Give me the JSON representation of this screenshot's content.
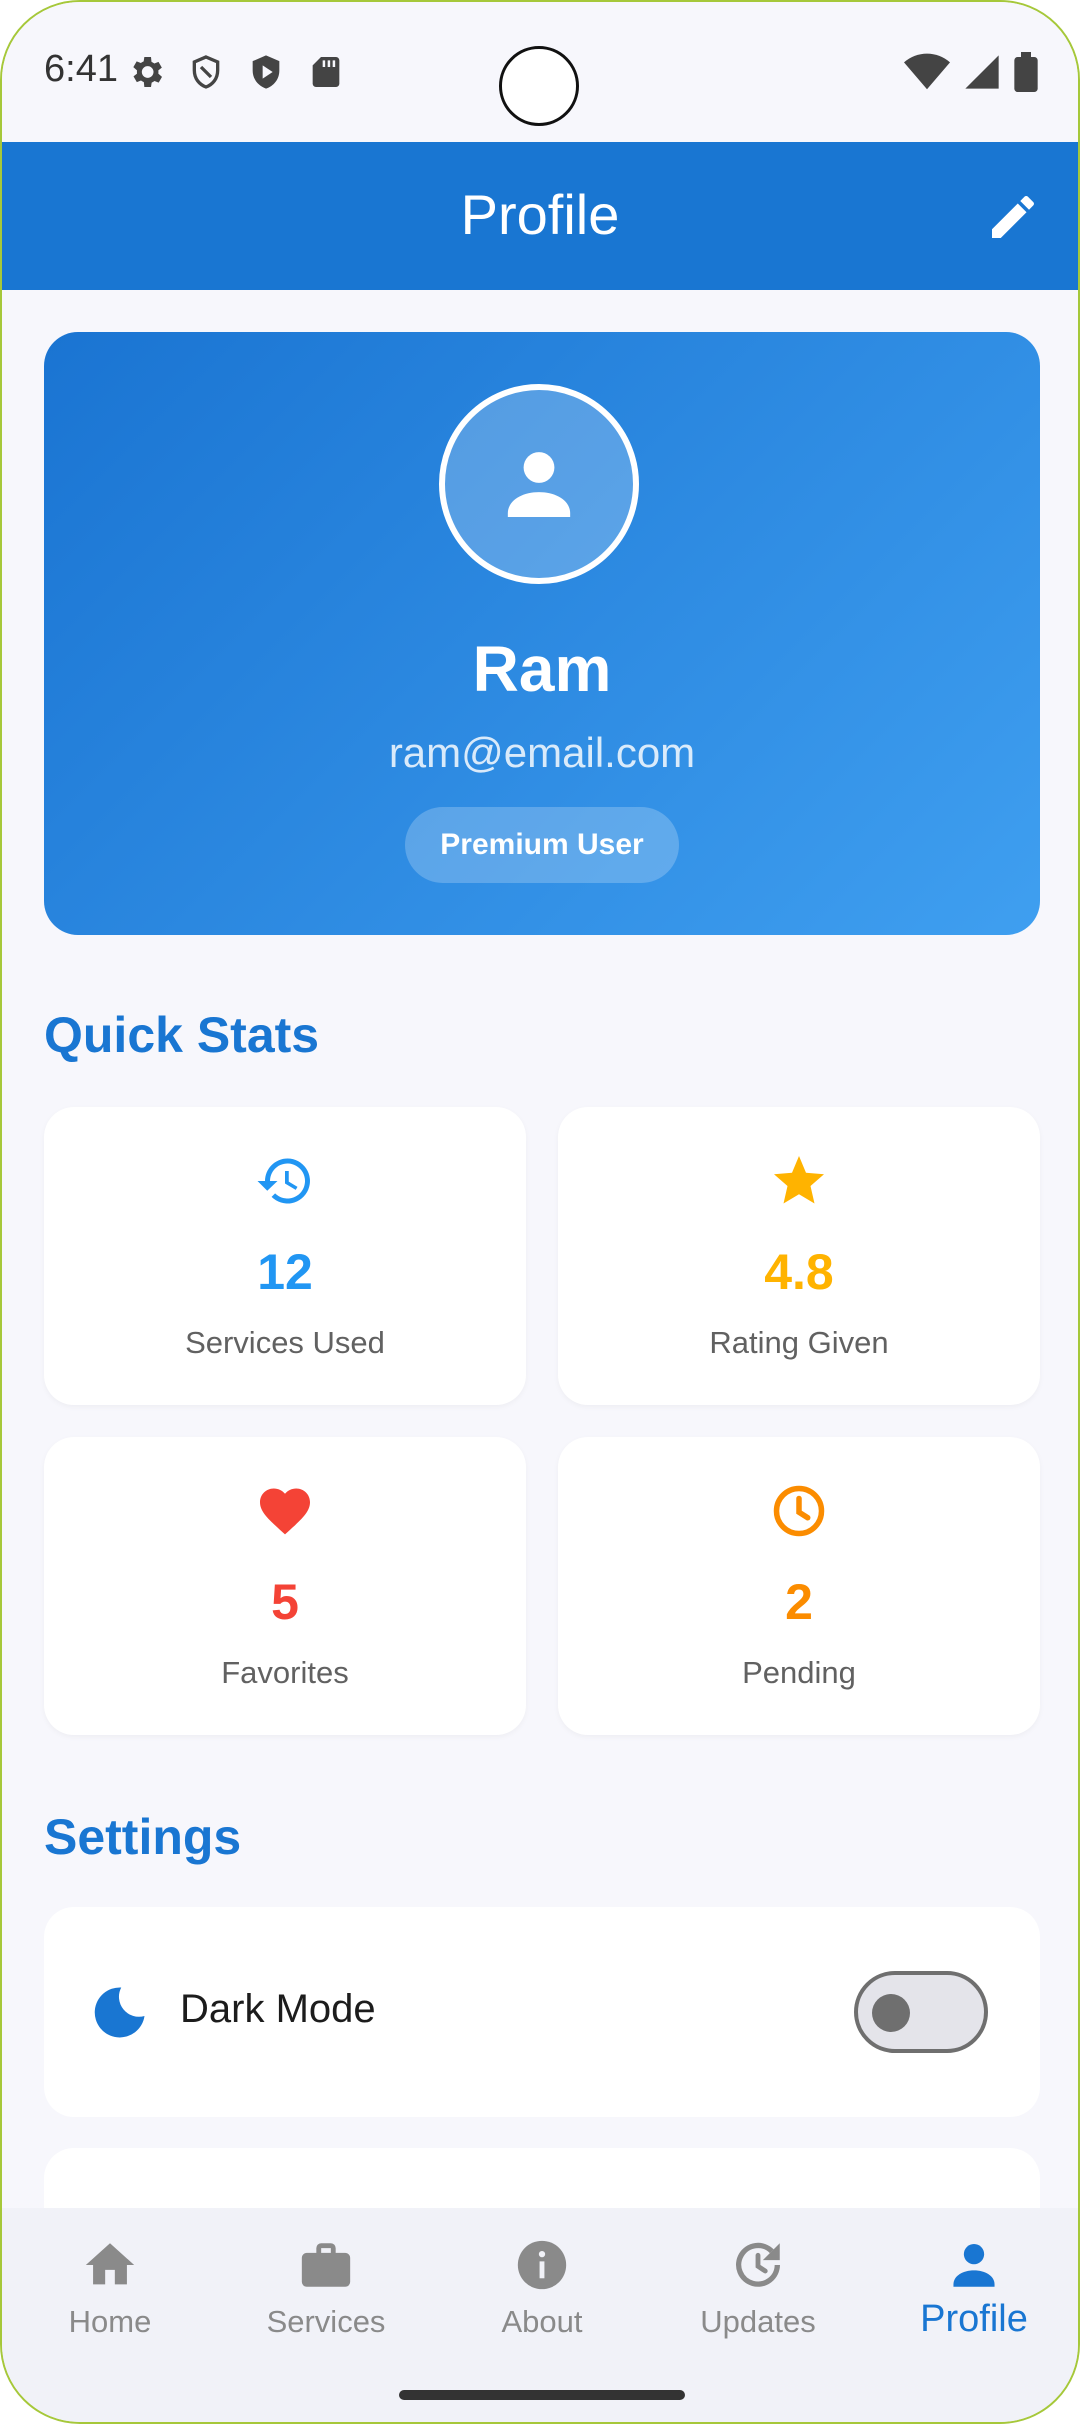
{
  "status_bar": {
    "time": "6:41",
    "icons_left": [
      "gear-icon",
      "shield-outline-icon",
      "shield-play-icon",
      "sd-card-icon"
    ],
    "icons_right": [
      "wifi-icon",
      "signal-icon",
      "battery-icon"
    ]
  },
  "app_bar": {
    "title": "Profile",
    "edit_icon": "pencil-icon",
    "color": "#1976d2"
  },
  "profile": {
    "avatar_icon": "person-icon",
    "name": "Ram",
    "email": "ram@email.com",
    "badge": "Premium User"
  },
  "quick_stats": {
    "title": "Quick Stats",
    "items": [
      {
        "icon": "history-icon",
        "value": "12",
        "label": "Services Used",
        "color": "#2196f3"
      },
      {
        "icon": "star-icon",
        "value": "4.8",
        "label": "Rating Given",
        "color": "#ffb300"
      },
      {
        "icon": "heart-icon",
        "value": "5",
        "label": "Favorites",
        "color": "#f44336"
      },
      {
        "icon": "clock-icon",
        "value": "2",
        "label": "Pending",
        "color": "#fb8c00"
      }
    ]
  },
  "settings": {
    "title": "Settings",
    "items": [
      {
        "icon": "moon-icon",
        "label": "Dark Mode",
        "toggle_on": false
      }
    ]
  },
  "bottom_nav": {
    "items": [
      {
        "icon": "home-icon",
        "label": "Home",
        "active": false
      },
      {
        "icon": "briefcase-icon",
        "label": "Services",
        "active": false
      },
      {
        "icon": "info-icon",
        "label": "About",
        "active": false
      },
      {
        "icon": "update-icon",
        "label": "Updates",
        "active": false
      },
      {
        "icon": "person-icon",
        "label": "Profile",
        "active": true
      }
    ],
    "active_color": "#1976d2",
    "inactive_color": "#8a8a8a"
  }
}
